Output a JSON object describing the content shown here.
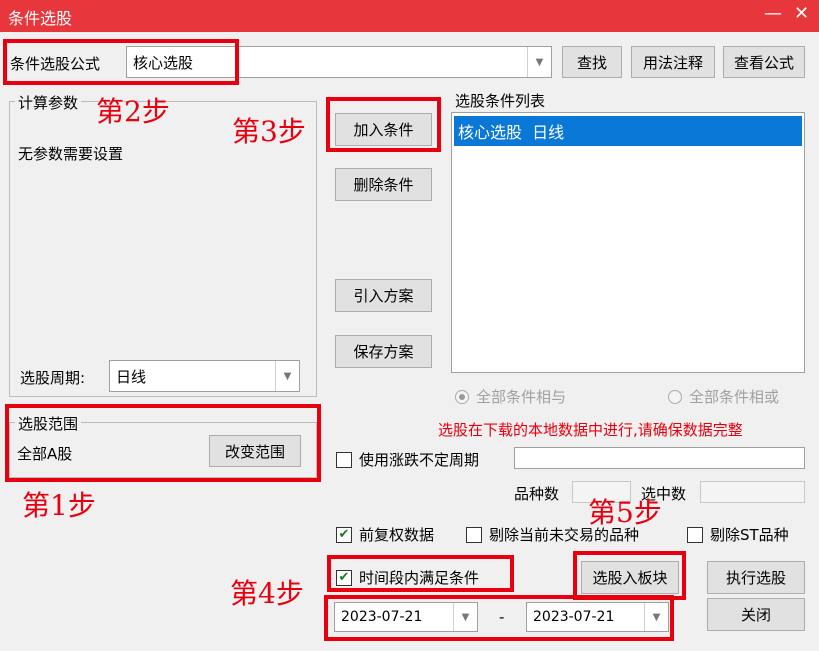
{
  "window": {
    "title": "条件选股",
    "minimize": "—",
    "close": "✕"
  },
  "formula": {
    "label": "条件选股公式",
    "value": "核心选股",
    "search_btn": "查找",
    "usage_btn": "用法注释",
    "view_btn": "查看公式"
  },
  "params": {
    "group_label": "计算参数",
    "no_params": "无参数需要设置",
    "period_label": "选股周期:",
    "period_value": "日线"
  },
  "scope": {
    "group_label": "选股范围",
    "value": "全部A股",
    "change_btn": "改变范围"
  },
  "actions": {
    "add": "加入条件",
    "delete": "删除条件",
    "import": "引入方案",
    "save": "保存方案"
  },
  "conditions": {
    "label": "选股条件列表",
    "items": [
      "核心选股  日线"
    ]
  },
  "logic": {
    "and_label": "全部条件相与",
    "or_label": "全部条件相或"
  },
  "warning": "选股在下载的本地数据中进行,请确保数据完整",
  "options": {
    "variable_period": "使用涨跌不定周期",
    "variety_count_label": "品种数",
    "selected_count_label": "选中数",
    "forward_adjust": "前复权数据",
    "exclude_untraded": "剔除当前未交易的品种",
    "exclude_st": "剔除ST品种",
    "time_range": "时间段内满足条件"
  },
  "dates": {
    "start": "2023-07-21",
    "separator": "-",
    "end": "2023-07-21"
  },
  "buttons": {
    "to_block": "选股入板块",
    "execute": "执行选股",
    "close": "关闭"
  },
  "steps": {
    "s1": "第1步",
    "s2": "第2步",
    "s3": "第3步",
    "s4": "第4步",
    "s5": "第5步"
  },
  "colors": {
    "titlebar": "#e8363d",
    "annotation": "#e8000f",
    "warning": "#e8000f",
    "selection": "#0a78d7"
  }
}
